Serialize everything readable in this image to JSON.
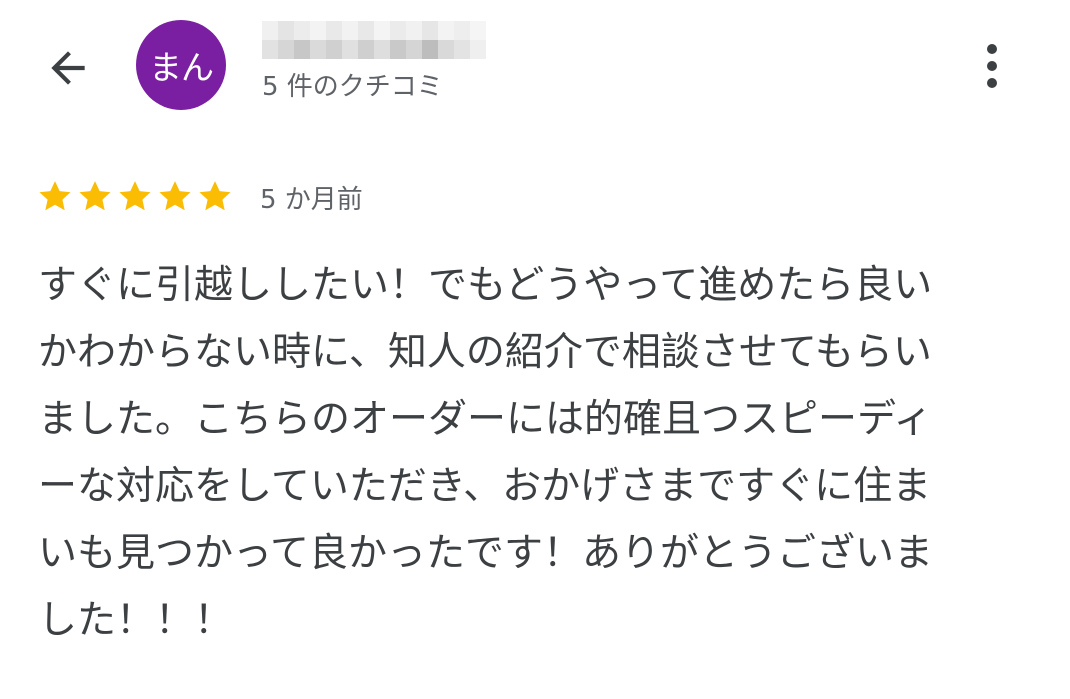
{
  "header": {
    "back_icon": "arrow-back-icon",
    "avatar_text": "まん",
    "avatar_color": "#7b1fa2",
    "reviewer_name_blurred": true,
    "review_count": "5 件のクチコミ",
    "more_icon": "more-vert-icon"
  },
  "review": {
    "rating": 5,
    "rating_max": 5,
    "star_color": "#fbbc04",
    "time_ago": "5 か月前",
    "lines": [
      "すぐに引越ししたい！でもどうやって進めたら良い",
      "かわからない時に、知人の紹介で相談させてもらい",
      "ました。こちらのオーダーには的確且つスピーディ",
      "ーな対応をしていただき、おかげさまですぐに住ま",
      "いも見つかって良かったです！ありがとうございま",
      "した！！！"
    ]
  }
}
